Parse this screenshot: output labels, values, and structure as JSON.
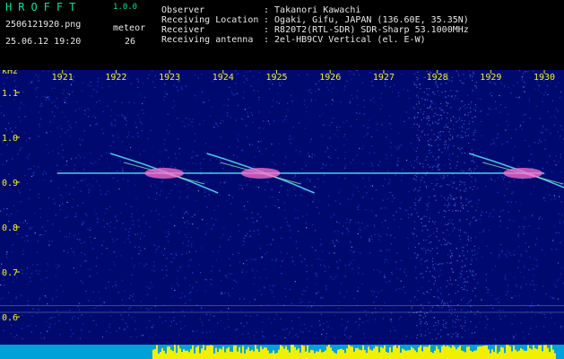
{
  "header": {
    "brand": "HROFFT",
    "version": "1.0.0",
    "filename": "2506121920.png",
    "datetime": "25.06.12 19:20",
    "meteor_label": "meteor",
    "meteor_count": "26"
  },
  "station": {
    "labels": [
      "Observer",
      "Receiving Location",
      "Receiver",
      "Receiving antenna"
    ],
    "values": [
      ": Takanori Kawachi",
      ": Ogaki, Gifu, JAPAN (136.60E, 35.35N)",
      ": R820T2(RTL-SDR) SDR-Sharp 53.1000MHz",
      ": 2el-HB9CV Vertical (el. E-W)"
    ]
  },
  "chart_data": {
    "type": "heatmap",
    "ylabel": "kHz",
    "x_ticks": [
      "1921",
      "1922",
      "1923",
      "1924",
      "1925",
      "1926",
      "1927",
      "1928",
      "1929",
      "1930"
    ],
    "y_ticks": [
      "1.1",
      "1.0",
      "0.9",
      "0.8",
      "0.7",
      "0.6"
    ],
    "ylim": [
      0.55,
      1.15
    ],
    "carrier_khz": 0.92,
    "meteor_echoes": [
      {
        "t": 1922.9,
        "f": 0.92
      },
      {
        "t": 1924.7,
        "f": 0.92
      },
      {
        "t": 1929.6,
        "f": 0.92
      }
    ],
    "colors": {
      "background": "#000a6e",
      "noise": "#2a50ff",
      "carrier": "#60e0ff",
      "echo": "#ff70d0",
      "activity": "#f0f000",
      "text": "#f0f020"
    }
  }
}
